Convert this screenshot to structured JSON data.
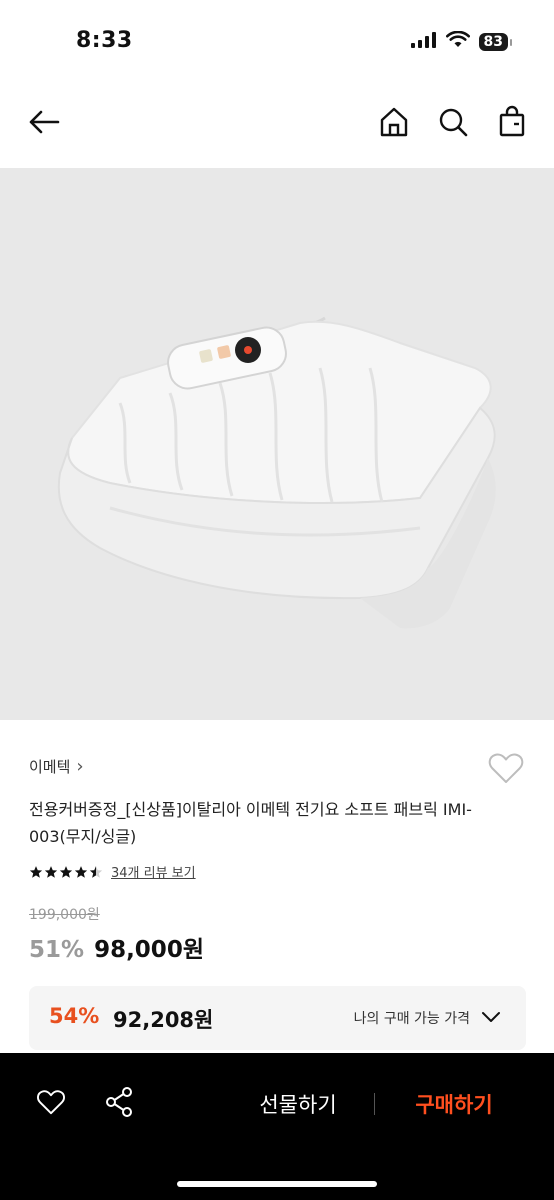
{
  "status_bar": {
    "time": "8:33",
    "battery": "83"
  },
  "header": {
    "back_icon": "arrow-left-icon",
    "home_icon": "home-icon",
    "search_icon": "search-icon",
    "bag_icon": "shopping-bag-icon"
  },
  "product": {
    "image_alt": "electric blanket",
    "brand": "이메텍",
    "brand_chevron": "›",
    "title": "전용커버증정_[신상품]이탈리아 이메텍 전기요 소프트 패브릭 IMI-003(무지/싱글)",
    "rating": 4.5,
    "review_link": "34개 리뷰 보기",
    "original_price": "199,000원",
    "discount_rate": "51%",
    "sale_price": "98,000원"
  },
  "my_price": {
    "discount_rate": "54%",
    "price": "92,208원",
    "label": "나의 구매 가능 가격"
  },
  "bottom_bar": {
    "wish_icon": "heart-icon",
    "share_icon": "share-icon",
    "gift_label": "선물하기",
    "buy_label": "구매하기"
  },
  "colors": {
    "accent_orange": "#e8501f",
    "buy_orange": "#ff4f1f",
    "image_bg": "#e8e8e8",
    "bottom_bar_bg": "#000000"
  }
}
